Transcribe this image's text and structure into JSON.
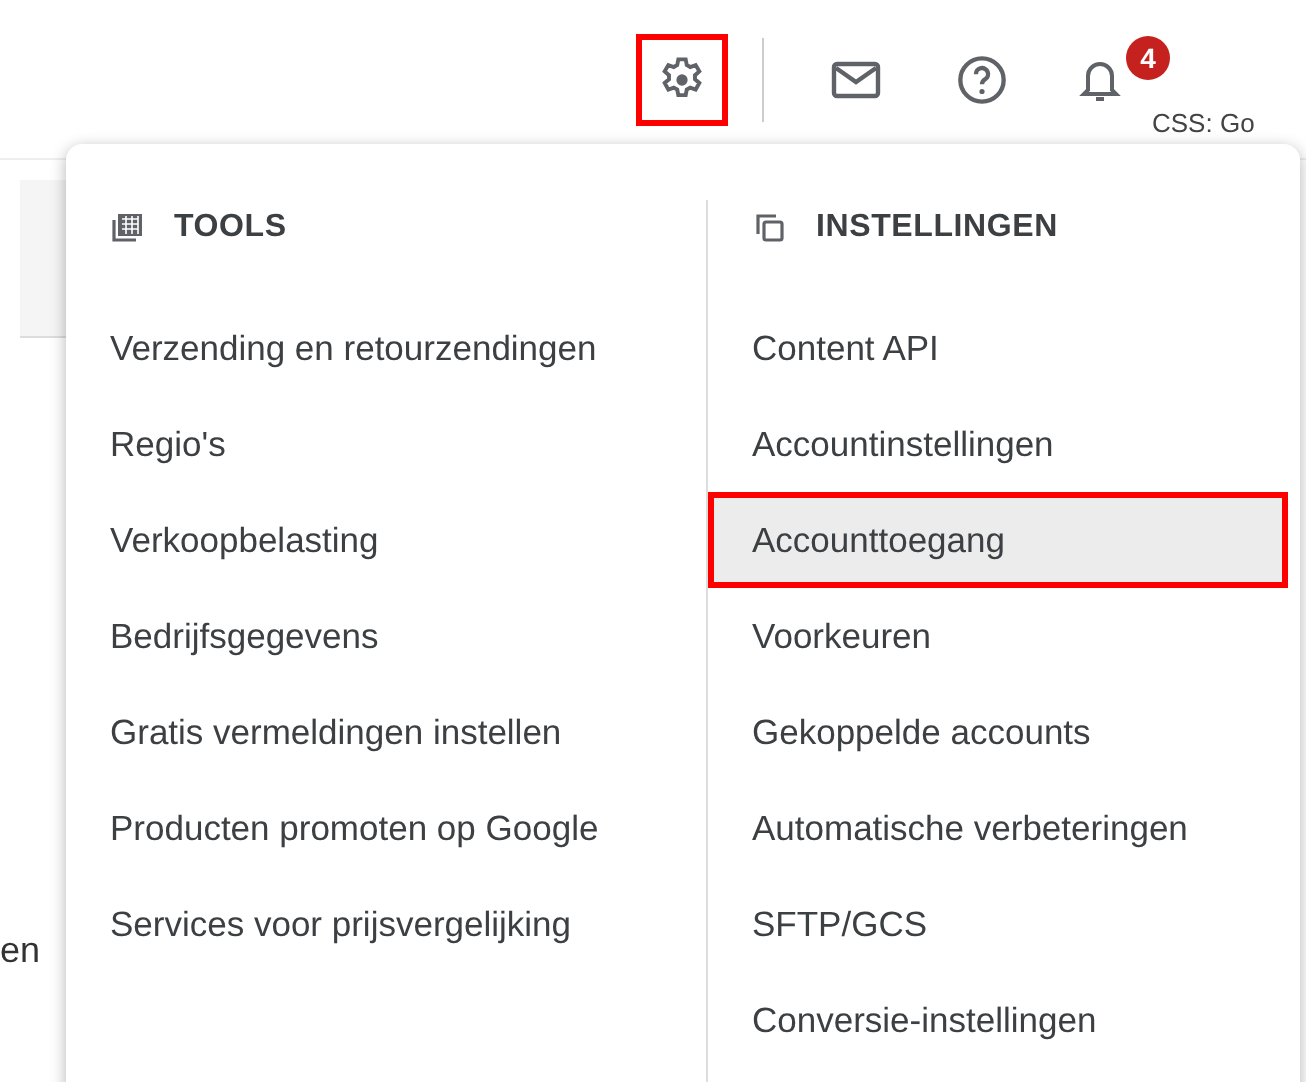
{
  "toolbar": {
    "settings_highlighted": true,
    "notification_count": "4",
    "side_text": "CSS: Go"
  },
  "background": {
    "partial_text": "en"
  },
  "menu": {
    "columns": [
      {
        "kind": "tools",
        "title": "TOOLS",
        "items": [
          {
            "label": "Verzending en retourzendingen",
            "highlighted": false
          },
          {
            "label": "Regio's",
            "highlighted": false
          },
          {
            "label": "Verkoopbelasting",
            "highlighted": false
          },
          {
            "label": "Bedrijfsgegevens",
            "highlighted": false
          },
          {
            "label": "Gratis vermeldingen instellen",
            "highlighted": false
          },
          {
            "label": "Producten promoten op Google",
            "highlighted": false
          },
          {
            "label": "Services voor prijsvergelijking",
            "highlighted": false
          }
        ]
      },
      {
        "kind": "settings",
        "title": "INSTELLINGEN",
        "items": [
          {
            "label": "Content API",
            "highlighted": false
          },
          {
            "label": "Accountinstellingen",
            "highlighted": false
          },
          {
            "label": "Accounttoegang",
            "highlighted": true
          },
          {
            "label": "Voorkeuren",
            "highlighted": false
          },
          {
            "label": "Gekoppelde accounts",
            "highlighted": false
          },
          {
            "label": "Automatische verbeteringen",
            "highlighted": false
          },
          {
            "label": "SFTP/GCS",
            "highlighted": false
          },
          {
            "label": "Conversie-instellingen",
            "highlighted": false
          }
        ]
      }
    ]
  }
}
